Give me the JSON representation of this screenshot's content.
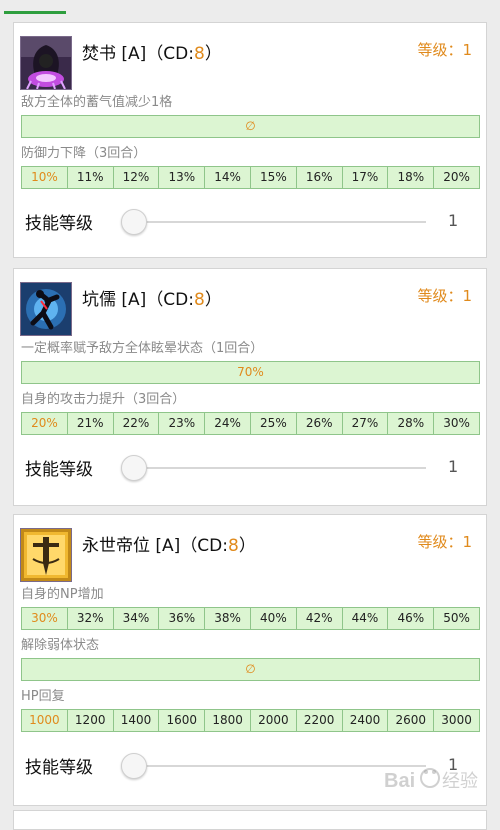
{
  "skills": [
    {
      "title": "焚书 [A]",
      "cd_prefix": "（CD:",
      "cd_value": "8",
      "cd_suffix": "）",
      "level": "等级：1",
      "effects": [
        {
          "label": "敌方全体的蓄气值减少1格",
          "single": "∅"
        },
        {
          "label": "防御力下降（3回合）",
          "values": [
            "10%",
            "11%",
            "12%",
            "13%",
            "14%",
            "15%",
            "16%",
            "17%",
            "18%",
            "20%"
          ]
        }
      ],
      "slider_label": "技能等级",
      "slider_value": "1",
      "slider_fraction": 0
    },
    {
      "title": "坑儒 [A]",
      "cd_prefix": "（CD:",
      "cd_value": "8",
      "cd_suffix": "）",
      "level": "等级：1",
      "effects": [
        {
          "label": "一定概率赋予敌方全体眩晕状态（1回合）",
          "single": "70%"
        },
        {
          "label": "自身的攻击力提升（3回合）",
          "values": [
            "20%",
            "21%",
            "22%",
            "23%",
            "24%",
            "25%",
            "26%",
            "27%",
            "28%",
            "30%"
          ]
        }
      ],
      "slider_label": "技能等级",
      "slider_value": "1",
      "slider_fraction": 0
    },
    {
      "title": "永世帝位 [A]",
      "cd_prefix": "（CD:",
      "cd_value": "8",
      "cd_suffix": "）",
      "level": "等级：1",
      "effects": [
        {
          "label": "自身的NP增加",
          "values": [
            "30%",
            "32%",
            "34%",
            "36%",
            "38%",
            "40%",
            "42%",
            "44%",
            "46%",
            "50%"
          ]
        },
        {
          "label": "解除弱体状态",
          "single": "∅"
        },
        {
          "label": "HP回复",
          "values": [
            "1000",
            "1200",
            "1400",
            "1600",
            "1800",
            "2000",
            "2200",
            "2400",
            "2600",
            "3000"
          ]
        }
      ],
      "slider_label": "技能等级",
      "slider_value": "1",
      "slider_fraction": 0
    }
  ],
  "colors": {
    "accent_orange": "#e08a1c",
    "bar_fill": "#dcf5d2",
    "bar_border": "#8fc58a",
    "tab_indicator": "#2e9e3e"
  },
  "watermark": "Bai 经验"
}
